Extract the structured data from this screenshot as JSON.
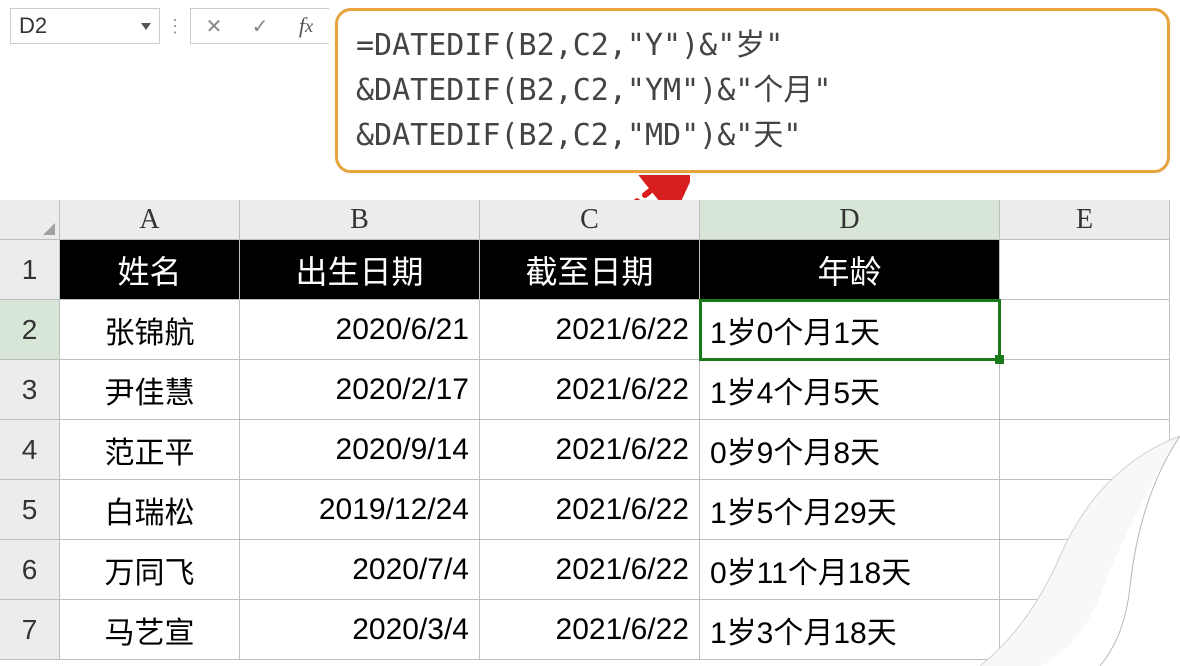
{
  "nameBox": "D2",
  "formula": {
    "line1": "=DATEDIF(B2,C2,\"Y\")&\"岁\"",
    "line2": "&DATEDIF(B2,C2,\"YM\")&\"个月\"",
    "line3": "&DATEDIF(B2,C2,\"MD\")&\"天\""
  },
  "columns": [
    "A",
    "B",
    "C",
    "D",
    "E"
  ],
  "rowNums": [
    "1",
    "2",
    "3",
    "4",
    "5",
    "6",
    "7"
  ],
  "activeCell": "D2",
  "chart_data": {
    "type": "table",
    "headers": [
      "姓名",
      "出生日期",
      "截至日期",
      "年龄"
    ],
    "rows": [
      [
        "张锦航",
        "2020/6/21",
        "2021/6/22",
        "1岁0个月1天"
      ],
      [
        "尹佳慧",
        "2020/2/17",
        "2021/6/22",
        "1岁4个月5天"
      ],
      [
        "范正平",
        "2020/9/14",
        "2021/6/22",
        "0岁9个月8天"
      ],
      [
        "白瑞松",
        "2019/12/24",
        "2021/6/22",
        "1岁5个月29天"
      ],
      [
        "万同飞",
        "2020/7/4",
        "2021/6/22",
        "0岁11个月18天"
      ],
      [
        "马艺宣",
        "2020/3/4",
        "2021/6/22",
        "1岁3个月18天"
      ]
    ]
  }
}
